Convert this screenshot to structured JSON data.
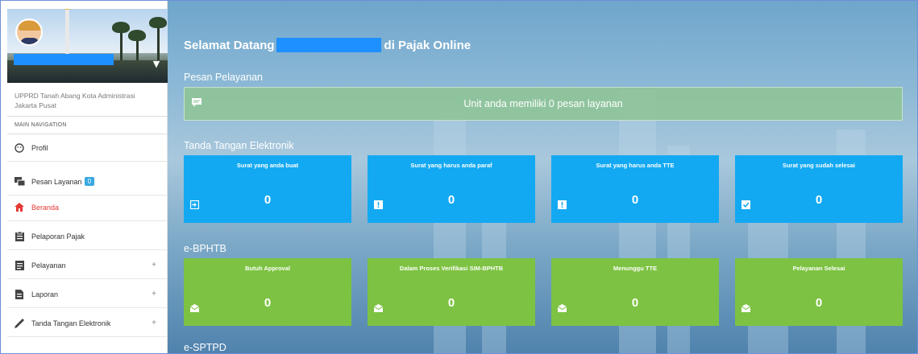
{
  "sidebar": {
    "org_line1": "UPPRD Tanah Abang Kota Administrasi",
    "org_line2": "Jakarta Pusat",
    "nav_header": "MAIN NAVIGATION",
    "items": [
      {
        "label": "Profil",
        "icon": "profile-icon"
      },
      {
        "label": "Pesan Layanan",
        "icon": "chat-icon",
        "badge": "0"
      },
      {
        "label": "Beranda",
        "icon": "home-icon",
        "active": true
      },
      {
        "label": "Pelaporan Pajak",
        "icon": "report-icon"
      },
      {
        "label": "Pelayanan",
        "icon": "document-icon",
        "expand": "+"
      },
      {
        "label": "Laporan",
        "icon": "file-icon",
        "expand": "+"
      },
      {
        "label": "Tanda Tangan Elektronik",
        "icon": "pen-icon",
        "expand": "+"
      }
    ]
  },
  "main": {
    "title_prefix": "Selamat Datang",
    "title_suffix": "di Pajak Online",
    "pesan_title": "Pesan Pelayanan",
    "pesan_message": "Unit anda memiliki 0 pesan layanan",
    "tte_title": "Tanda Tangan Elektronik",
    "tte_cards": [
      {
        "label": "Surat yang anda buat",
        "value": "0",
        "icon": "sign-in-icon"
      },
      {
        "label": "Surat yang harus anda paraf",
        "value": "0",
        "icon": "alert-icon"
      },
      {
        "label": "Surat yang harus anda TTE",
        "value": "0",
        "icon": "alert-icon"
      },
      {
        "label": "Surat yang sudah selesai",
        "value": "0",
        "icon": "check-icon"
      }
    ],
    "bphtb_title": "e-BPHTB",
    "bphtb_cards": [
      {
        "label": "Butuh Approval",
        "value": "0",
        "icon": "envelope-icon"
      },
      {
        "label": "Dalam Proses Verifikasi SIM-BPHTB",
        "value": "0",
        "icon": "envelope-icon"
      },
      {
        "label": "Menunggu TTE",
        "value": "0",
        "icon": "envelope-icon"
      },
      {
        "label": "Pelayanan Selesai",
        "value": "0",
        "icon": "envelope-icon"
      }
    ],
    "sptpd_title": "e-SPTPD"
  },
  "colors": {
    "card_blue": "#13a9f2",
    "card_green": "#7dc242",
    "message_bar": "#8fc498",
    "active_nav": "#e53935",
    "badge": "#39a8e0",
    "redaction": "#1e90ff"
  }
}
